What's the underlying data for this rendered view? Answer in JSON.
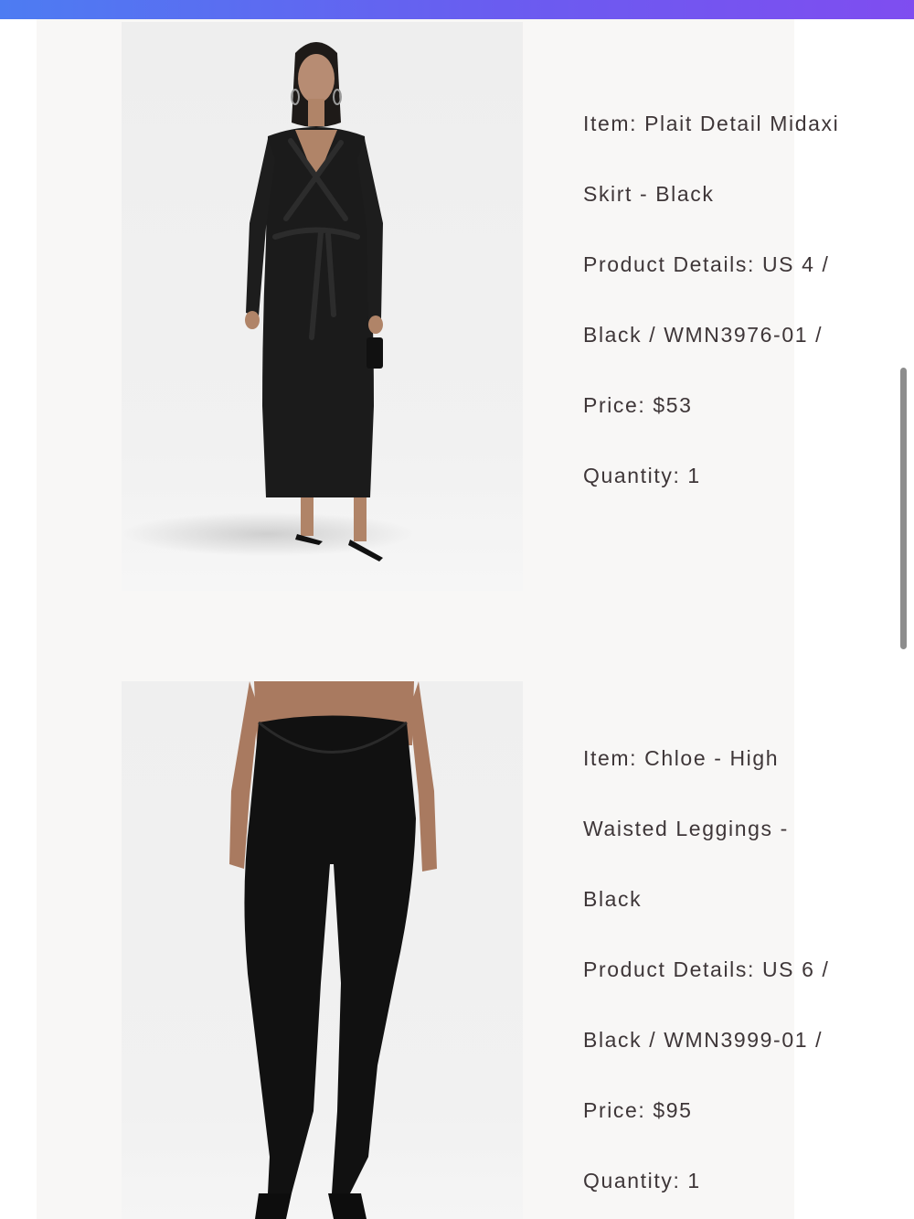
{
  "products": [
    {
      "image_alt": "Model wearing plait detail midaxi skirt in black",
      "item_lines": [
        "Item: Plait Detail Midaxi",
        "Skirt - Black"
      ],
      "details_lines": [
        "Product Details: US 4 /",
        "Black / WMN3976-01 /"
      ],
      "price": "Price: $53",
      "quantity": "Quantity: 1"
    },
    {
      "image_alt": "Model wearing Chloe high waisted leggings in black",
      "item_lines": [
        "Item: Chloe - High",
        "Waisted Leggings -",
        "Black"
      ],
      "details_lines": [
        "Product Details: US 6 /",
        "Black / WMN3999-01 /"
      ],
      "price": "Price: $95",
      "quantity": "Quantity: 1"
    }
  ],
  "colors": {
    "header_gradient_start": "#4d7cf2",
    "header_gradient_end": "#7f4df0",
    "panel_background": "#f8f7f6",
    "text": "#3e3638",
    "scrollbar": "#8d8d8d"
  }
}
